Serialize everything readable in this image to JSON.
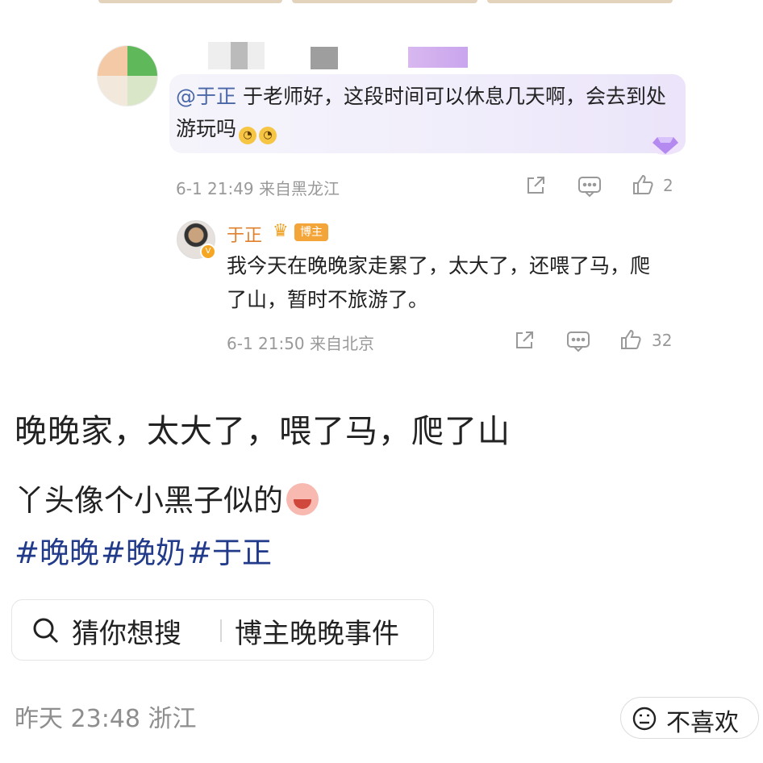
{
  "comment": {
    "mention": "@于正",
    "text": "于老师好，这段时间可以休息几天啊，会去到处游玩吗",
    "emoji": "smirk-emoji",
    "meta": "6-1 21:49 来自黑龙江",
    "like_count": "2"
  },
  "reply": {
    "author": "于正",
    "badge": "博主",
    "text": "我今天在晚晚家走累了，太大了，还喂了马，爬了山，暂时不旅游了。",
    "meta": "6-1 21:50 来自北京",
    "like_count": "32"
  },
  "post": {
    "line1": "晚晚家，太大了，喂了马，爬了山",
    "line2": "丫头像个小黑子似的",
    "hashtags": [
      "#晚晚",
      "#晚奶",
      "#于正"
    ]
  },
  "search": {
    "prefix": "猜你想搜",
    "term": "博主晚晚事件"
  },
  "footer": {
    "meta": "昨天 23:48 浙江",
    "dislike_label": "不喜欢"
  },
  "colors": {
    "link": "#223a8a",
    "author_orange": "#e0802d",
    "meta_gray": "#999999"
  }
}
